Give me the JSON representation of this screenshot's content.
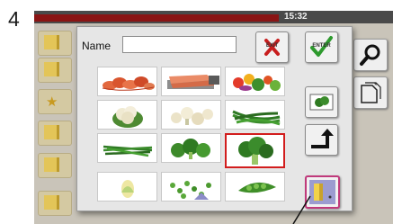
{
  "step_number": "4",
  "status_bar": {
    "time": "15:32"
  },
  "dialog": {
    "name_label": "Name",
    "name_value": "",
    "cancel_button_label": "EXIT",
    "confirm_button_label": "ENTER",
    "selected_image": "broccoli"
  },
  "image_grid": [
    {
      "name": "shrimp"
    },
    {
      "name": "salmon-fillet"
    },
    {
      "name": "mixed-vegetables"
    },
    {
      "name": "cauliflower"
    },
    {
      "name": "cauliflower-florets"
    },
    {
      "name": "green-beans-bunch"
    },
    {
      "name": "green-beans"
    },
    {
      "name": "broccoli-florets"
    },
    {
      "name": "broccoli"
    },
    {
      "name": "corn"
    },
    {
      "name": "peas"
    },
    {
      "name": "pea-pods"
    }
  ],
  "colors": {
    "selection_border": "#d21d1d",
    "status_bar_accent": "#8a1414",
    "confirm_check": "#2e9a2e",
    "cancel_x": "#c81e1e"
  }
}
